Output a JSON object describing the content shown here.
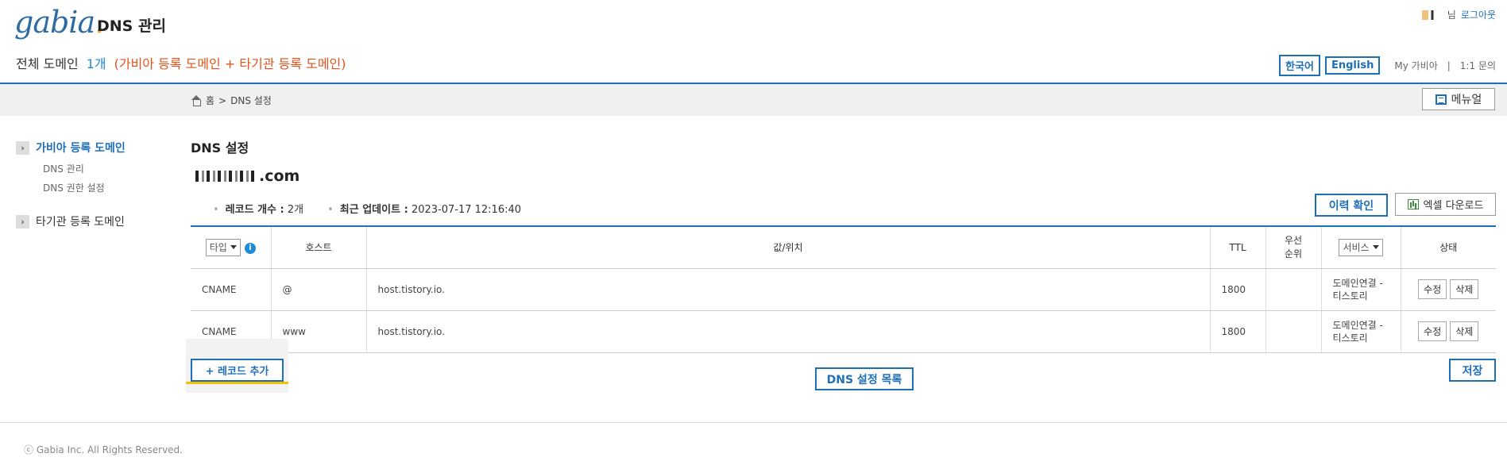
{
  "header": {
    "logo": "gabia",
    "logo_dot": ".",
    "title": "DNS 관리",
    "user_suffix": "님",
    "logout": "로그아웃",
    "domain_count_label": "전체 도메인",
    "domain_count_value": "1개",
    "domain_count_sub": "(가비아 등록 도메인 + 타기관 등록 도메인)",
    "lang_korean": "한국어",
    "lang_english": "English",
    "my_gabia": "My 가비아",
    "separator": "|",
    "inquiry": "1:1 문의"
  },
  "breadcrumb": {
    "home": "홈",
    "sep": ">",
    "current": "DNS 설정"
  },
  "manual_label": "메뉴얼",
  "sidebar": {
    "group1": "가비아 등록 도메인",
    "group1_items": [
      "DNS 관리",
      "DNS 권한 설정"
    ],
    "group2": "타기관 등록 도메인"
  },
  "main": {
    "section_title": "DNS 설정",
    "domain_suffix": ".com",
    "record_count_label": "레코드 개수 :",
    "record_count_value": "2개",
    "last_update_label": "최근 업데이트 :",
    "last_update_value": "2023-07-17 12:16:40",
    "history_button": "이력 확인",
    "excel_button": "엑셀 다운로드"
  },
  "table": {
    "type_select": "타입",
    "info": "i",
    "headers": {
      "host": "호스트",
      "value": "값/위치",
      "ttl": "TTL",
      "priority": "우선\n순위",
      "service_select": "서비스",
      "status": "상태"
    },
    "rows": [
      {
        "type": "CNAME",
        "host": "@",
        "value": "host.tistory.io.",
        "ttl": "1800",
        "priority": "",
        "service_line1": "도메인연결 -",
        "service_line2": "티스토리",
        "edit": "수정",
        "delete": "삭제"
      },
      {
        "type": "CNAME",
        "host": "www",
        "value": "host.tistory.io.",
        "ttl": "1800",
        "priority": "",
        "service_line1": "도메인연결 -",
        "service_line2": "티스토리",
        "edit": "수정",
        "delete": "삭제"
      }
    ]
  },
  "buttons": {
    "add_record": "+ 레코드 추가",
    "dns_list": "DNS 설정 목록",
    "save": "저장"
  },
  "footer": "ⓒ Gabia Inc. All Rights Reserved."
}
